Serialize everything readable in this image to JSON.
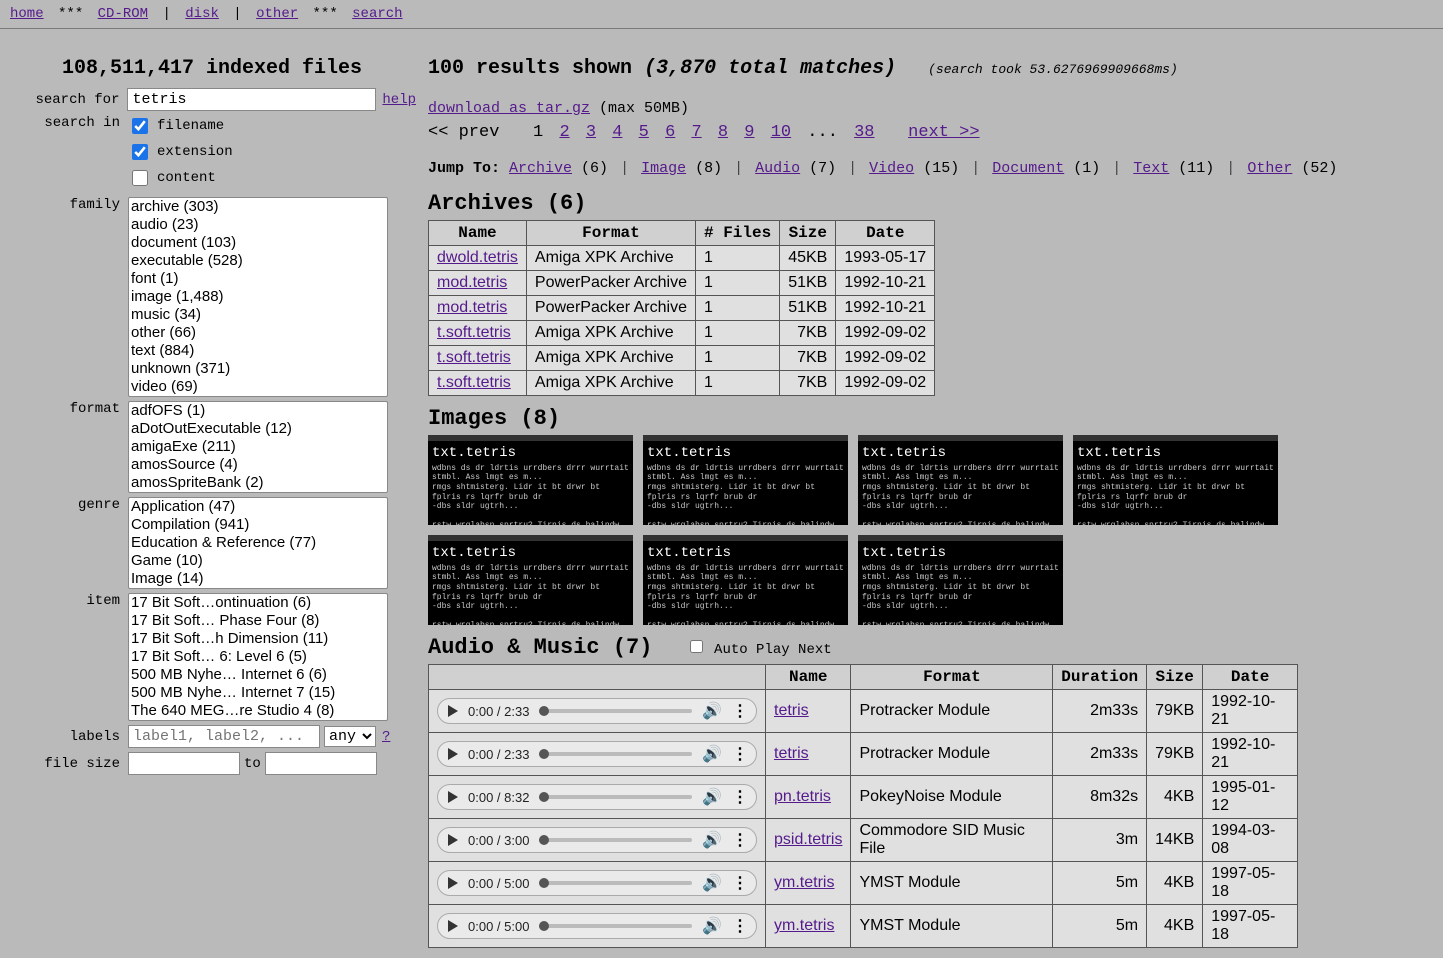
{
  "nav": {
    "home": "home",
    "cdrom": "CD-ROM",
    "disk": "disk",
    "other": "other",
    "search": "search",
    "sep_star": "***",
    "sep_pipe": "|"
  },
  "sidebar": {
    "indexed_count": "108,511,417 indexed files",
    "search_for": "search for",
    "search_value": "tetris",
    "help": "help",
    "search_in": "search in",
    "check_filename": "filename",
    "check_extension": "extension",
    "check_content": "content",
    "family": "family",
    "family_opts": [
      "archive (303)",
      "audio (23)",
      "document (103)",
      "executable (528)",
      "font (1)",
      "image (1,488)",
      "music (34)",
      "other (66)",
      "text (884)",
      "unknown (371)",
      "video (69)"
    ],
    "format": "format",
    "format_opts": [
      "adfOFS (1)",
      "aDotOutExecutable (12)",
      "amigaExe (211)",
      "amosSource (4)",
      "amosSpriteBank (2)"
    ],
    "genre": "genre",
    "genre_opts": [
      "Application (47)",
      "Compilation (941)",
      "Education & Reference (77)",
      "Game (10)",
      "Image (14)"
    ],
    "item": "item",
    "item_opts": [
      "17 Bit Soft…ontinuation (6)",
      "17 Bit Soft… Phase Four (8)",
      "17 Bit Soft…h Dimension (11)",
      "17 Bit Soft… 6: Level 6 (5)",
      "500 MB Nyhe… Internet 6 (6)",
      "500 MB Nyhe… Internet 7 (15)",
      "The 640 MEG…re Studio 4 (8)"
    ],
    "labels": "labels",
    "labels_placeholder": "label1, label2, ...",
    "labels_any": "any",
    "labels_q": "?",
    "file_size": "file size",
    "to": "to"
  },
  "results": {
    "shown": "100 results shown",
    "total": "(3,870 total matches)",
    "took": "(search took 53.6276969909668ms)",
    "download": "download as tar.gz",
    "maxsize": "(max 50MB)",
    "pager": {
      "prev": "<< prev",
      "current": "1",
      "pages": [
        "2",
        "3",
        "4",
        "5",
        "6",
        "7",
        "8",
        "9",
        "10"
      ],
      "dots": "...",
      "last": "38",
      "next": "next >>"
    },
    "jump": {
      "label": "Jump To:",
      "items": [
        {
          "name": "Archive",
          "count": "(6)"
        },
        {
          "name": "Image",
          "count": "(8)"
        },
        {
          "name": "Audio",
          "count": "(7)"
        },
        {
          "name": "Video",
          "count": "(15)"
        },
        {
          "name": "Document",
          "count": "(1)"
        },
        {
          "name": "Text",
          "count": "(11)"
        },
        {
          "name": "Other",
          "count": "(52)"
        }
      ]
    }
  },
  "archives": {
    "title": "Archives (6)",
    "headers": [
      "Name",
      "Format",
      "# Files",
      "Size",
      "Date"
    ],
    "rows": [
      {
        "name": "dwold.tetris",
        "format": "Amiga XPK Archive",
        "files": "1",
        "size": "45KB",
        "date": "1993-05-17"
      },
      {
        "name": "mod.tetris",
        "format": "PowerPacker Archive",
        "files": "1",
        "size": "51KB",
        "date": "1992-10-21"
      },
      {
        "name": "mod.tetris",
        "format": "PowerPacker Archive",
        "files": "1",
        "size": "51KB",
        "date": "1992-10-21"
      },
      {
        "name": "t.soft.tetris",
        "format": "Amiga XPK Archive",
        "files": "1",
        "size": "7KB",
        "date": "1992-09-02"
      },
      {
        "name": "t.soft.tetris",
        "format": "Amiga XPK Archive",
        "files": "1",
        "size": "7KB",
        "date": "1992-09-02"
      },
      {
        "name": "t.soft.tetris",
        "format": "Amiga XPK Archive",
        "files": "1",
        "size": "7KB",
        "date": "1992-09-02"
      }
    ]
  },
  "images": {
    "title": "Images (8)",
    "thumbs": [
      "txt.tetris",
      "txt.tetris",
      "txt.tetris",
      "txt.tetris",
      "txt.tetris",
      "txt.tetris",
      "txt.tetris"
    ]
  },
  "audio": {
    "title": "Audio & Music (7)",
    "autoplay": "Auto Play Next",
    "headers": [
      "",
      "Name",
      "Format",
      "Duration",
      "Size",
      "Date"
    ],
    "rows": [
      {
        "time": "0:00 / 2:33",
        "name": "tetris",
        "format": "Protracker Module",
        "dur": "2m33s",
        "size": "79KB",
        "date": "1992-10-21"
      },
      {
        "time": "0:00 / 2:33",
        "name": "tetris",
        "format": "Protracker Module",
        "dur": "2m33s",
        "size": "79KB",
        "date": "1992-10-21"
      },
      {
        "time": "0:00 / 8:32",
        "name": "pn.tetris",
        "format": "PokeyNoise Module",
        "dur": "8m32s",
        "size": "4KB",
        "date": "1995-01-12"
      },
      {
        "time": "0:00 / 3:00",
        "name": "psid.tetris",
        "format": "Commodore SID Music File",
        "dur": "3m",
        "size": "14KB",
        "date": "1994-03-08"
      },
      {
        "time": "0:00 / 5:00",
        "name": "ym.tetris",
        "format": "YMST Module",
        "dur": "5m",
        "size": "4KB",
        "date": "1997-05-18"
      },
      {
        "time": "0:00 / 5:00",
        "name": "ym.tetris",
        "format": "YMST Module",
        "dur": "5m",
        "size": "4KB",
        "date": "1997-05-18"
      }
    ]
  }
}
